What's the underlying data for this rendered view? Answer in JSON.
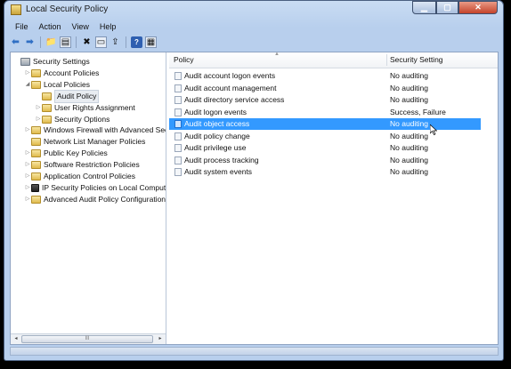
{
  "window": {
    "title": "Local Security Policy"
  },
  "menu": [
    "File",
    "Action",
    "View",
    "Help"
  ],
  "toolbar": [
    {
      "name": "back-arrow-icon",
      "glyph": "⬅"
    },
    {
      "name": "forward-arrow-icon",
      "glyph": "➡"
    },
    {
      "name": "up-folder-icon",
      "glyph": "📁"
    },
    {
      "name": "show-hide-tree-icon",
      "glyph": "▤"
    },
    {
      "name": "delete-icon",
      "glyph": "✖"
    },
    {
      "name": "properties-icon",
      "glyph": "▭"
    },
    {
      "name": "export-list-icon",
      "glyph": "⇪"
    },
    {
      "name": "help-icon",
      "glyph": "?"
    },
    {
      "name": "show-action-pane-icon",
      "glyph": "▦"
    }
  ],
  "tree": [
    {
      "label": "Security Settings",
      "twisty": "",
      "icon": "sec",
      "indent": 0
    },
    {
      "label": "Account Policies",
      "twisty": "▷",
      "icon": "folder",
      "indent": 1
    },
    {
      "label": "Local Policies",
      "twisty": "◢",
      "icon": "folder",
      "indent": 1
    },
    {
      "label": "Audit Policy",
      "twisty": "",
      "icon": "folder",
      "indent": 2,
      "selected": true
    },
    {
      "label": "User Rights Assignment",
      "twisty": "▷",
      "icon": "folder",
      "indent": 2
    },
    {
      "label": "Security Options",
      "twisty": "▷",
      "icon": "folder",
      "indent": 2
    },
    {
      "label": "Windows Firewall with Advanced Secu",
      "twisty": "▷",
      "icon": "folder",
      "indent": 1
    },
    {
      "label": "Network List Manager Policies",
      "twisty": "",
      "icon": "folder",
      "indent": 1
    },
    {
      "label": "Public Key Policies",
      "twisty": "▷",
      "icon": "folder",
      "indent": 1
    },
    {
      "label": "Software Restriction Policies",
      "twisty": "▷",
      "icon": "folder",
      "indent": 1
    },
    {
      "label": "Application Control Policies",
      "twisty": "▷",
      "icon": "folder",
      "indent": 1
    },
    {
      "label": "IP Security Policies on Local Compute",
      "twisty": "▷",
      "icon": "ip",
      "indent": 1
    },
    {
      "label": "Advanced Audit Policy Configuration",
      "twisty": "▷",
      "icon": "folder",
      "indent": 1
    }
  ],
  "columns": {
    "policy": "Policy",
    "setting": "Security Setting"
  },
  "policies": [
    {
      "name": "Audit account logon events",
      "setting": "No auditing"
    },
    {
      "name": "Audit account management",
      "setting": "No auditing"
    },
    {
      "name": "Audit directory service access",
      "setting": "No auditing"
    },
    {
      "name": "Audit logon events",
      "setting": "Success, Failure"
    },
    {
      "name": "Audit object access",
      "setting": "No auditing",
      "selected": true
    },
    {
      "name": "Audit policy change",
      "setting": "No auditing"
    },
    {
      "name": "Audit privilege use",
      "setting": "No auditing"
    },
    {
      "name": "Audit process tracking",
      "setting": "No auditing"
    },
    {
      "name": "Audit system events",
      "setting": "No auditing"
    }
  ],
  "scroll": {
    "thumb_glyph": "III",
    "left_arrow": "◂",
    "right_arrow": "▸"
  }
}
